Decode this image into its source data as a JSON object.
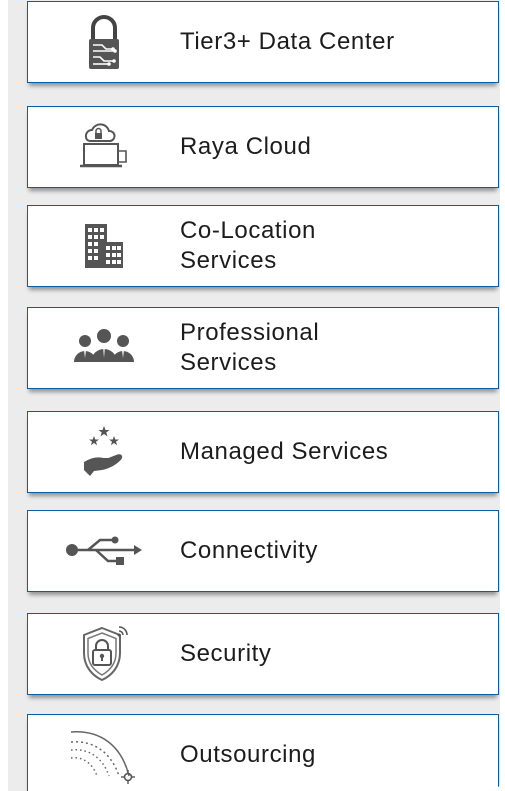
{
  "menu": {
    "items": [
      {
        "label": "Tier3+ Data Center",
        "icon": "padlock-circuit-icon"
      },
      {
        "label": "Raya Cloud",
        "icon": "cloud-laptop-icon"
      },
      {
        "label": "Co-Location\nServices",
        "icon": "buildings-icon"
      },
      {
        "label": "Professional\nServices",
        "icon": "team-icon"
      },
      {
        "label": "Managed Services",
        "icon": "hand-stars-icon"
      },
      {
        "label": "Connectivity",
        "icon": "usb-icon"
      },
      {
        "label": "Security",
        "icon": "shield-lock-icon"
      },
      {
        "label": "Outsourcing",
        "icon": "satellite-signal-icon"
      }
    ]
  },
  "colors": {
    "card_border": "#0a5ea8",
    "panel_bg": "#ececec",
    "text": "#1c1c1c",
    "icon": "#555555"
  }
}
